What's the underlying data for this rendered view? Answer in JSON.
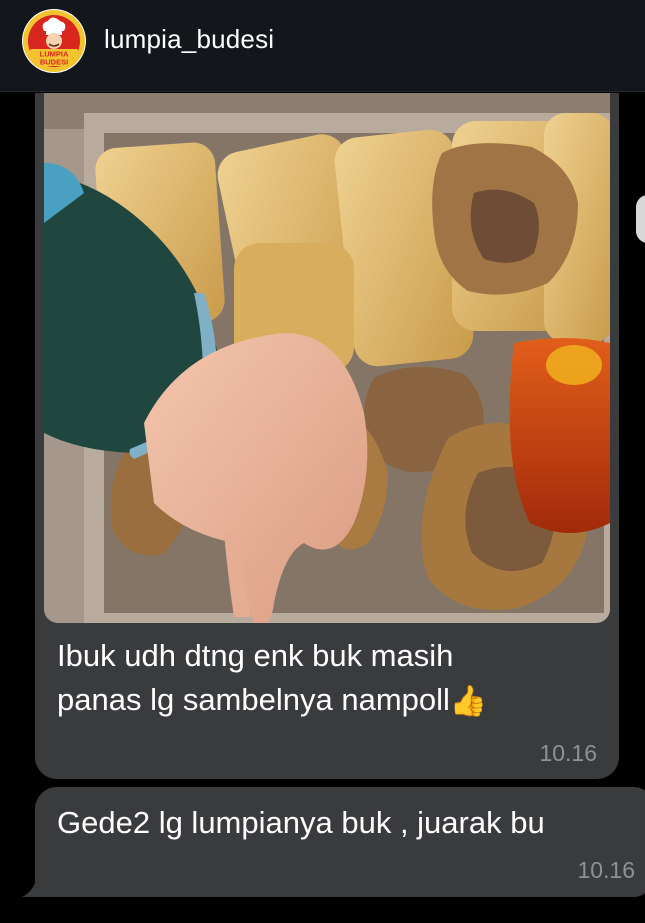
{
  "header": {
    "username": "lumpia_budesi",
    "avatar_logo_text": "LUMPIA BUDESI",
    "avatar_icon": "chef-logo-icon"
  },
  "messages": [
    {
      "type": "photo",
      "image_description_icon": "food-photo",
      "text": "Ibuk udh dtng enk buk masih\npanas lg sambelnya nampoll",
      "emoji": "👍",
      "time": "10.16"
    },
    {
      "type": "text",
      "text": "Gede2 lg lumpianya buk , juarak bu",
      "time": "10.16"
    }
  ],
  "colors": {
    "background": "#000000",
    "header": "#13171b",
    "bubble": "#3a3b3d",
    "timestamp": "#8e9094",
    "text": "#ffffff"
  }
}
